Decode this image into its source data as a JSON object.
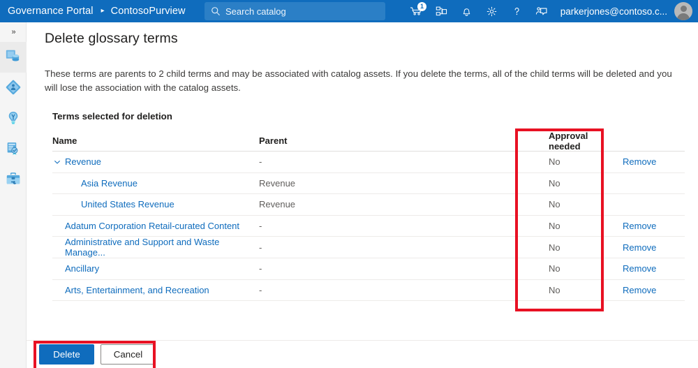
{
  "header": {
    "brand_root": "Governance Portal",
    "brand_separator": "▸",
    "brand_current": "ContosoPurview",
    "search_placeholder": "Search catalog",
    "search_value": "",
    "notification_count": "1",
    "username": "parkerjones@contoso.c...",
    "icons": [
      "cart-icon",
      "data-map-icon",
      "notification-bell-icon",
      "settings-gear-icon",
      "help-question-icon",
      "feedback-icon"
    ],
    "accent_color": "#0f6cbd"
  },
  "sidebar": {
    "collapse_label": "»",
    "items": [
      {
        "name": "data-map",
        "label": "Data map",
        "active": true
      },
      {
        "name": "data-estate-insights",
        "label": "Data estate",
        "active": false
      },
      {
        "name": "glossary",
        "label": "Glossary",
        "active": false
      },
      {
        "name": "insights",
        "label": "Insights",
        "active": false
      },
      {
        "name": "management",
        "label": "Management",
        "active": false
      }
    ]
  },
  "main": {
    "title": "Delete glossary terms",
    "description": "These terms are parents to 2 child terms and may be associated with catalog assets. If you delete the terms, all of the child terms will be deleted and you will lose the association with the catalog assets.",
    "section_label": "Terms selected for deletion"
  },
  "table": {
    "columns": {
      "name": "Name",
      "parent": "Parent",
      "approval": "Approval needed",
      "action": ""
    },
    "rows": [
      {
        "name": "Revenue",
        "parent": "-",
        "approval": "No",
        "action": "Remove",
        "indent": 0,
        "expandable": true,
        "expanded": true
      },
      {
        "name": "Asia Revenue",
        "parent": "Revenue",
        "approval": "No",
        "action": "",
        "indent": 2,
        "expandable": false,
        "expanded": false
      },
      {
        "name": "United States Revenue",
        "parent": "Revenue",
        "approval": "No",
        "action": "",
        "indent": 2,
        "expandable": false,
        "expanded": false
      },
      {
        "name": "Adatum Corporation Retail-curated Content",
        "parent": "-",
        "approval": "No",
        "action": "Remove",
        "indent": 1,
        "expandable": false,
        "expanded": false
      },
      {
        "name": "Administrative and Support and Waste Manage...",
        "parent": "-",
        "approval": "No",
        "action": "Remove",
        "indent": 1,
        "expandable": false,
        "expanded": false
      },
      {
        "name": "Ancillary",
        "parent": "-",
        "approval": "No",
        "action": "Remove",
        "indent": 1,
        "expandable": false,
        "expanded": false
      },
      {
        "name": "Arts, Entertainment, and Recreation",
        "parent": "-",
        "approval": "No",
        "action": "Remove",
        "indent": 1,
        "expandable": false,
        "expanded": false
      }
    ]
  },
  "footer": {
    "delete_label": "Delete",
    "cancel_label": "Cancel"
  },
  "annotations": {
    "highlight_color": "#e81123",
    "boxes": [
      {
        "name": "approval-needed-column-highlight"
      },
      {
        "name": "action-buttons-highlight"
      }
    ]
  }
}
